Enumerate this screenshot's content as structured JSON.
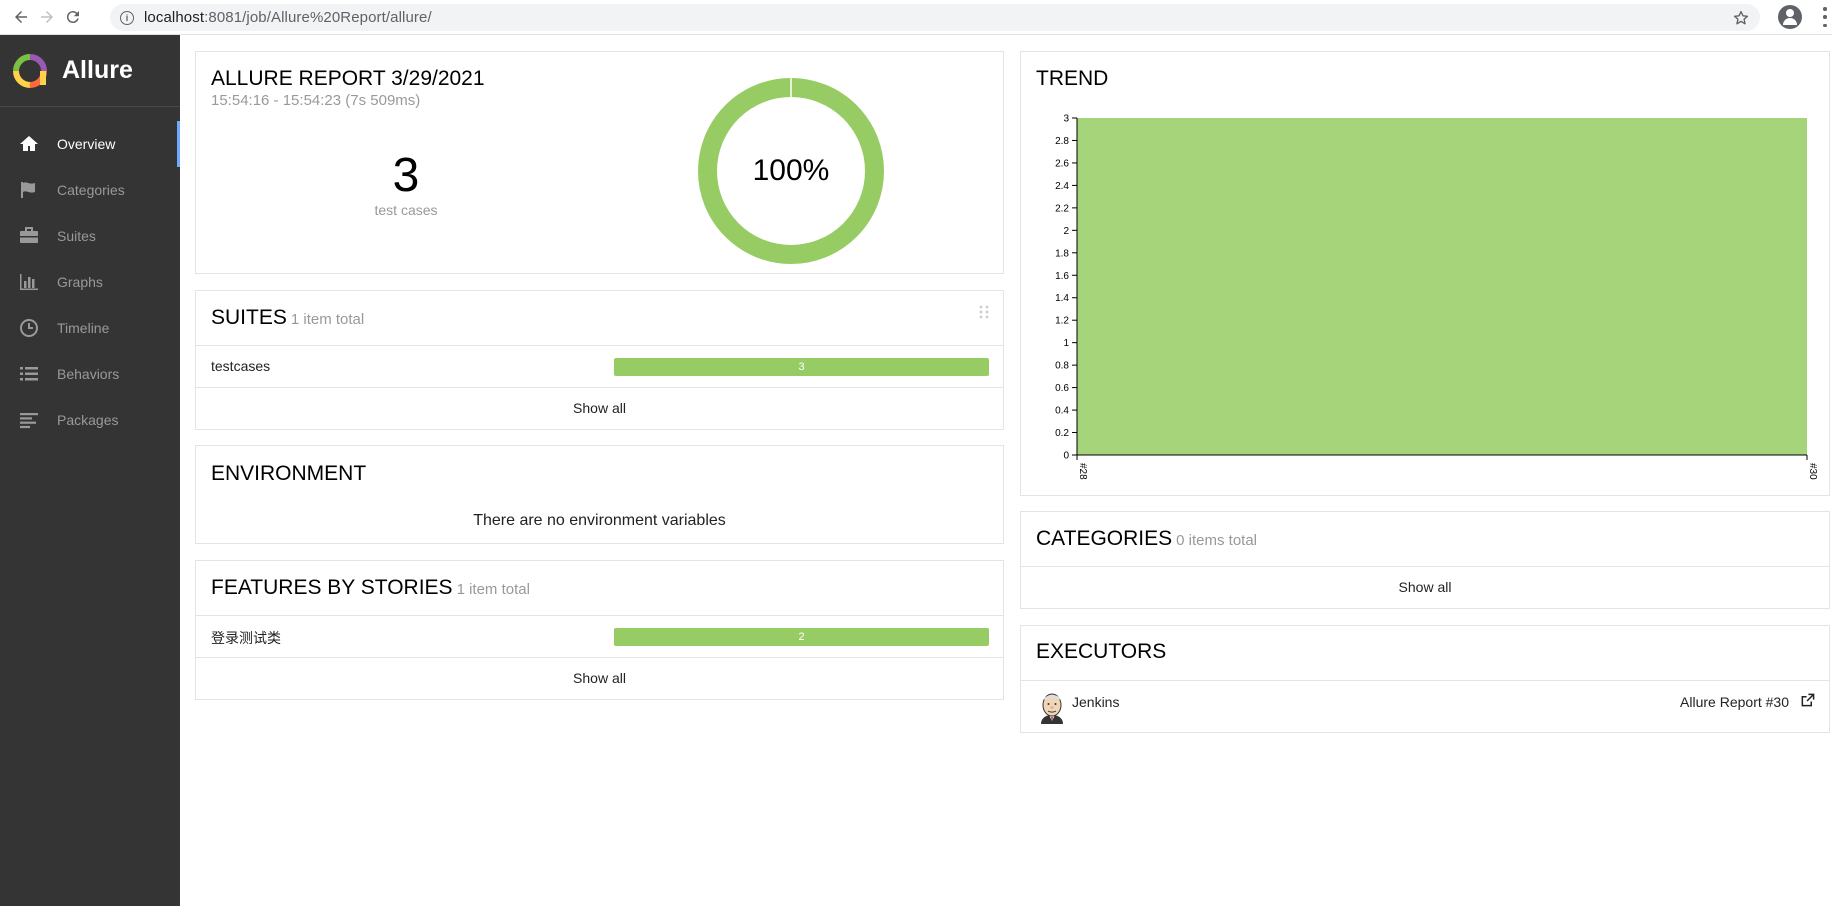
{
  "browser": {
    "url_host": "localhost",
    "url_rest": ":8081/job/Allure%20Report/allure/"
  },
  "sidebar": {
    "brand": "Allure",
    "items": [
      {
        "label": "Overview",
        "icon": "home-icon"
      },
      {
        "label": "Categories",
        "icon": "flag-icon"
      },
      {
        "label": "Suites",
        "icon": "briefcase-icon"
      },
      {
        "label": "Graphs",
        "icon": "bar-chart-icon"
      },
      {
        "label": "Timeline",
        "icon": "clock-icon"
      },
      {
        "label": "Behaviors",
        "icon": "list-icon"
      },
      {
        "label": "Packages",
        "icon": "align-left-icon"
      }
    ]
  },
  "summary": {
    "title": "ALLURE REPORT 3/29/2021",
    "time": "15:54:16 - 15:54:23 (7s 509ms)",
    "count": "3",
    "count_label": "test cases",
    "percent": "100%",
    "percent_value": 100
  },
  "suites": {
    "title": "SUITES",
    "subtitle": "1 item total",
    "rows": [
      {
        "name": "testcases",
        "value": "3"
      }
    ],
    "show_all": "Show all"
  },
  "environment": {
    "title": "ENVIRONMENT",
    "empty": "There are no environment variables"
  },
  "features": {
    "title": "FEATURES BY STORIES",
    "subtitle": "1 item total",
    "rows": [
      {
        "name": "登录测试类",
        "value": "2"
      }
    ],
    "show_all": "Show all"
  },
  "trend": {
    "title": "TREND"
  },
  "categories": {
    "title": "CATEGORIES",
    "subtitle": "0 items total",
    "show_all": "Show all"
  },
  "executors": {
    "title": "EXECUTORS",
    "name": "Jenkins",
    "build": "Allure Report #30"
  },
  "colors": {
    "passed": "#97cc64",
    "sidebar": "#343434",
    "accent": "#6ea8ff"
  },
  "chart_data": {
    "type": "area",
    "x": [
      "#28",
      "#30"
    ],
    "series": [
      {
        "values": [
          3,
          3
        ]
      }
    ],
    "ylim": [
      0,
      3
    ],
    "yticks": [
      "0",
      "0.2",
      "0.4",
      "0.6",
      "0.8",
      "1",
      "1.2",
      "1.4",
      "1.6",
      "1.8",
      "2",
      "2.2",
      "2.4",
      "2.6",
      "2.8",
      "3"
    ],
    "grid": false
  }
}
